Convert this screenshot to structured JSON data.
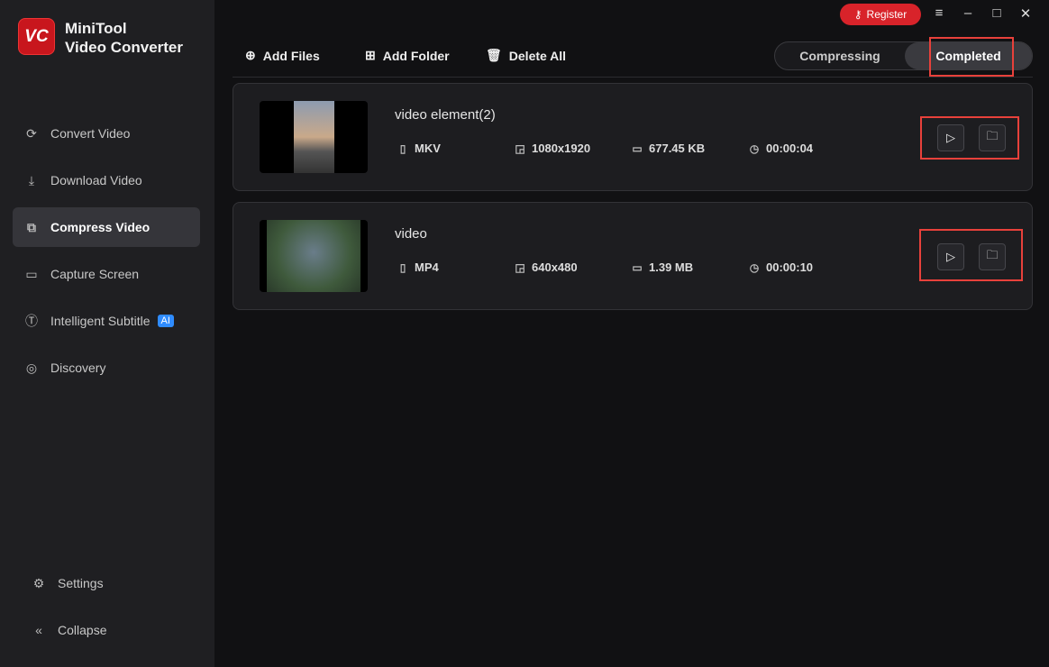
{
  "app": {
    "logo_text": "VC",
    "name_line1": "MiniTool",
    "name_line2": "Video Converter"
  },
  "sidebar": {
    "items": [
      {
        "label": "Convert Video",
        "icon": "convert-icon"
      },
      {
        "label": "Download Video",
        "icon": "download-icon"
      },
      {
        "label": "Compress Video",
        "icon": "compress-icon",
        "active": true
      },
      {
        "label": "Capture Screen",
        "icon": "camera-icon"
      },
      {
        "label": "Intelligent Subtitle",
        "icon": "subtitle-icon",
        "badge": "AI"
      },
      {
        "label": "Discovery",
        "icon": "compass-icon"
      }
    ],
    "settings": "Settings",
    "collapse": "Collapse"
  },
  "header": {
    "register": "Register"
  },
  "toolbar": {
    "add_files": "Add Files",
    "add_folder": "Add Folder",
    "delete_all": "Delete All"
  },
  "tabs": {
    "compressing": "Compressing",
    "completed": "Completed"
  },
  "files": [
    {
      "name": "video element(2)",
      "format": "MKV",
      "resolution": "1080x1920",
      "size": "677.45 KB",
      "duration": "00:00:04"
    },
    {
      "name": "video",
      "format": "MP4",
      "resolution": "640x480",
      "size": "1.39 MB",
      "duration": "00:00:10"
    }
  ]
}
